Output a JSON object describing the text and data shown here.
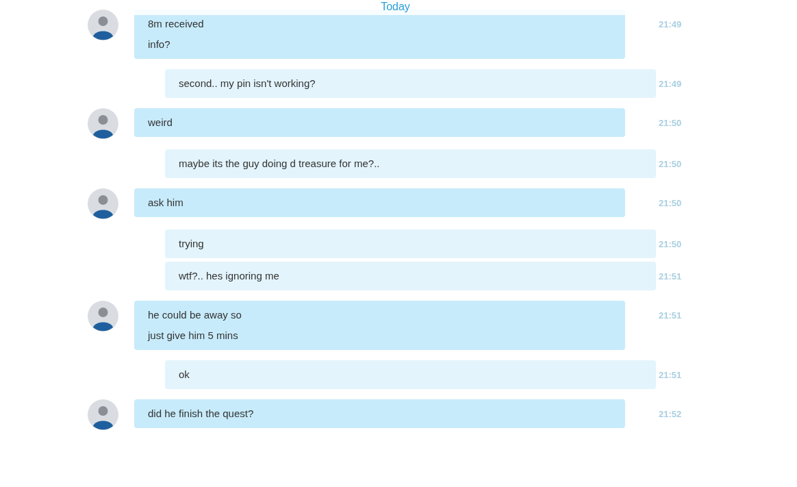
{
  "header": {
    "date": "Today"
  },
  "messages": [
    {
      "kind": "incoming",
      "lines": [
        "8m received",
        "info?"
      ],
      "time": "21:49"
    },
    {
      "kind": "outgoing",
      "lines": [
        "second.. my pin isn't working?"
      ],
      "time": "21:49"
    },
    {
      "kind": "incoming",
      "lines": [
        "weird"
      ],
      "time": "21:50"
    },
    {
      "kind": "outgoing",
      "lines": [
        "maybe its the guy doing d treasure for me?.."
      ],
      "time": "21:50"
    },
    {
      "kind": "incoming",
      "lines": [
        "ask him"
      ],
      "time": "21:50"
    },
    {
      "kind": "outgoing",
      "lines": [
        "trying"
      ],
      "time": "21:50"
    },
    {
      "kind": "outgoing",
      "lines": [
        "wtf?.. hes ignoring me"
      ],
      "time": "21:51"
    },
    {
      "kind": "incoming",
      "lines": [
        "he could be away so",
        "just give him 5 mins"
      ],
      "time": "21:51"
    },
    {
      "kind": "outgoing",
      "lines": [
        "ok"
      ],
      "time": "21:51"
    },
    {
      "kind": "incoming",
      "lines": [
        "did he finish the quest?"
      ],
      "time": "21:52"
    }
  ]
}
